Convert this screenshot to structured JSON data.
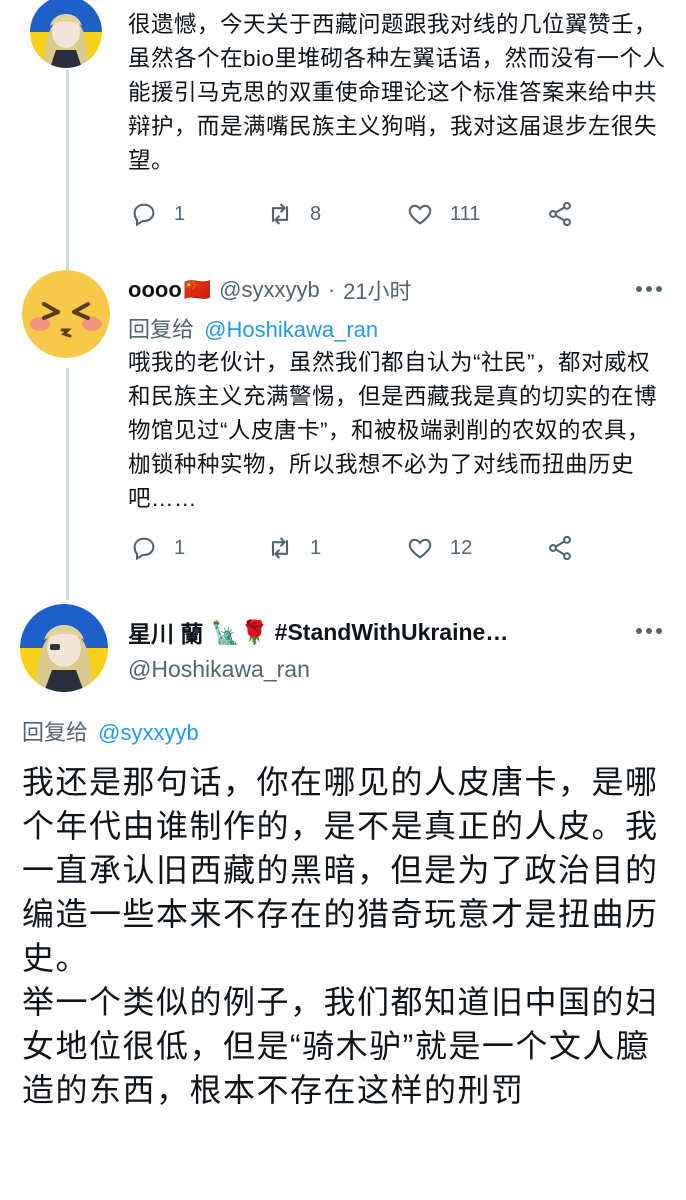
{
  "tweet1": {
    "text": "很遗憾，今天关于西藏问题跟我对线的几位翼赞壬，虽然各个在bio里堆砌各种左翼话语，然而没有一个人能援引马克思的双重使命理论这个标准答案来给中共辩护，而是满嘴民族主义狗哨，我对这届退步左很失望。",
    "replies": "1",
    "retweets": "8",
    "likes": "111"
  },
  "tweet2": {
    "name": "oooo",
    "flag": "🇨🇳",
    "handle": "@syxxyyb",
    "separator": "·",
    "time": "21小时",
    "reply_prefix": "回复给",
    "reply_to": "@Hoshikawa_ran",
    "text": "哦我的老伙计，虽然我们都自认为“社民”，都对威权和民族主义充满警惕，但是西藏我是真的切实的在博物馆见过“人皮唐卡”，和被极端剥削的农奴的农具，枷锁种种实物，所以我想不必为了对线而扭曲历史吧……",
    "replies": "1",
    "retweets": "1",
    "likes": "12"
  },
  "tweet3": {
    "name": "星川 蘭",
    "emoji": "🗽🌹",
    "hashtag": "#StandWithUkraine…",
    "handle": "@Hoshikawa_ran",
    "reply_prefix": "回复给",
    "reply_to": "@syxxyyb",
    "paragraph1": "我还是那句话，你在哪见的人皮唐卡，是哪个年代由谁制作的，是不是真正的人皮。我一直承认旧西藏的黑暗，但是为了政治目的编造一些本来不存在的猎奇玩意才是扭曲历史。",
    "paragraph2": "举一个类似的例子，我们都知道旧中国的妇女地位很低，但是“骑木驴”就是一个文人臆造的东西，根本不存在这样的刑罚"
  },
  "icons": {
    "reply": "reply-icon",
    "retweet": "retweet-icon",
    "like": "heart-icon",
    "share": "share-icon",
    "more": "more-icon"
  },
  "colors": {
    "link": "#1d9bf0",
    "muted": "#536471",
    "thread_line": "#cfd9de",
    "ukraine_blue": "#1f5fc9",
    "ukraine_yellow": "#f6d21b"
  }
}
